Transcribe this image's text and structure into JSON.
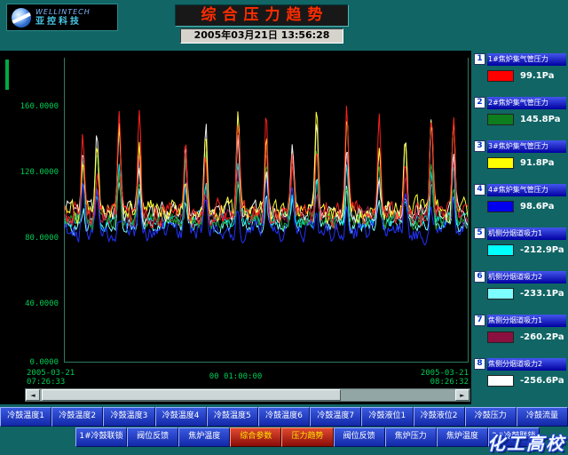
{
  "header": {
    "logo": {
      "line1": "WELLINTECH",
      "line2": "亚控科技"
    },
    "title": "综合压力趋势",
    "datetime": "2005年03月21日  13:56:28"
  },
  "chart_data": {
    "type": "line",
    "title": "综合压力趋势",
    "ylim": [
      0,
      187
    ],
    "y_ticks": [
      "160.0000",
      "120.0000",
      "80.0000",
      "40.0000",
      "0.0000"
    ],
    "x_start_date": "2005-03-21",
    "x_start_time": "07:26:33",
    "x_window": "00 01:00:00",
    "x_end_date": "2005-03-21",
    "x_end_time": "08:26:32",
    "grid": false,
    "legend_position": "right",
    "seed": 20050321,
    "spike_positions": [
      0.045,
      0.08,
      0.135,
      0.185,
      0.3,
      0.35,
      0.43,
      0.5,
      0.565,
      0.625,
      0.7,
      0.78,
      0.845,
      0.91,
      0.965
    ],
    "series": [
      {
        "name": "机侧分烟道吸力2",
        "color": "#7dffff",
        "current_value": "-233.1Pa",
        "baseline": 84,
        "noise": 7,
        "spike": 28
      },
      {
        "name": "机侧分烟道吸力1",
        "color": "#00e5e5",
        "current_value": "-212.9Pa",
        "baseline": 87,
        "noise": 8,
        "spike": 35
      },
      {
        "name": "焦侧分烟道吸力1",
        "color": "#a02050",
        "current_value": "-260.2Pa",
        "baseline": 89,
        "noise": 9,
        "spike": 40
      },
      {
        "name": "4#焦炉集气管压力",
        "color": "#2233ff",
        "current_value": "98.6Pa",
        "baseline": 80,
        "noise": 10,
        "spike": 30
      },
      {
        "name": "2#焦炉集气管压力",
        "color": "#1e9e2e",
        "current_value": "145.8Pa",
        "baseline": 88,
        "noise": 9,
        "spike": 45
      },
      {
        "name": "焦侧分烟道吸力2",
        "color": "#f0f0f0",
        "current_value": "-256.6Pa",
        "baseline": 92,
        "noise": 10,
        "spike": 55
      },
      {
        "name": "3#焦炉集气管压力",
        "color": "#ffff33",
        "current_value": "91.8Pa",
        "baseline": 93,
        "noise": 11,
        "spike": 60
      },
      {
        "name": "1#焦炉集气管压力",
        "color": "#ff2020",
        "current_value": "99.1Pa",
        "baseline": 91,
        "noise": 12,
        "spike": 65
      }
    ]
  },
  "legend": {
    "items": [
      {
        "num": "1",
        "label": "1#焦炉集气管压力",
        "color": "#ff0000",
        "value": "99.1Pa"
      },
      {
        "num": "2",
        "label": "2#焦炉集气管压力",
        "color": "#0e7d1e",
        "value": "145.8Pa"
      },
      {
        "num": "3",
        "label": "3#焦炉集气管压力",
        "color": "#ffff00",
        "value": "91.8Pa"
      },
      {
        "num": "4",
        "label": "4#焦炉集气管压力",
        "color": "#0000ee",
        "value": "98.6Pa"
      },
      {
        "num": "5",
        "label": "机侧分烟道吸力1",
        "color": "#00ffff",
        "value": "-212.9Pa"
      },
      {
        "num": "6",
        "label": "机侧分烟道吸力2",
        "color": "#7dffff",
        "value": "-233.1Pa"
      },
      {
        "num": "7",
        "label": "焦侧分烟道吸力1",
        "color": "#8a1040",
        "value": "-260.2Pa"
      },
      {
        "num": "8",
        "label": "焦侧分烟道吸力2",
        "color": "#ffffff",
        "value": "-256.6Pa"
      }
    ]
  },
  "nav": {
    "row1": [
      "冷鼓温度1",
      "冷鼓温度2",
      "冷鼓温度3",
      "冷鼓温度4",
      "冷鼓温度5",
      "冷鼓温度6",
      "冷鼓温度7",
      "冷鼓液位1",
      "冷鼓液位2",
      "冷鼓压力",
      "冷鼓流量"
    ],
    "row2": [
      {
        "label": "1#冷鼓联锁",
        "active": false
      },
      {
        "label": "阀位反馈",
        "active": false
      },
      {
        "label": "焦炉温度",
        "active": false
      },
      {
        "label": "综合参数",
        "active": true
      },
      {
        "label": "压力趋势",
        "active": true
      },
      {
        "label": "阀位反馈",
        "active": false
      },
      {
        "label": "焦炉压力",
        "active": false
      },
      {
        "label": "焦炉温度",
        "active": false
      },
      {
        "label": "2#冷鼓联锁",
        "active": false
      }
    ]
  },
  "scrollbar": {
    "left_arrow": "◄",
    "right_arrow": "►"
  },
  "watermark": "化工高校"
}
